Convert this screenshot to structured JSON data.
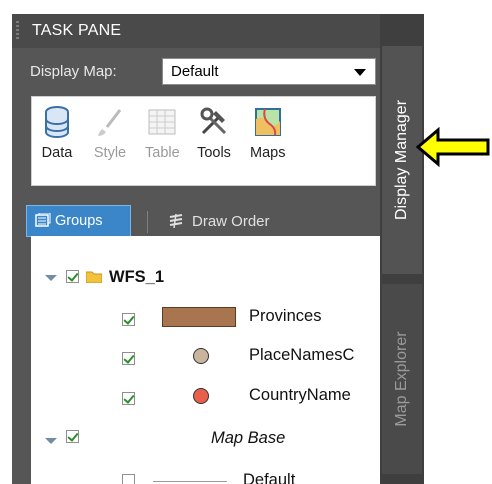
{
  "task_pane": {
    "title": "TASK PANE",
    "display_map_label": "Display Map:",
    "display_map_value": "Default"
  },
  "toolbar": {
    "data": "Data",
    "style": "Style",
    "table": "Table",
    "tools": "Tools",
    "maps": "Maps"
  },
  "view_tabs": {
    "groups": "Groups",
    "draw_order": "Draw Order"
  },
  "layers": {
    "group1": {
      "name": "WFS_1",
      "checked": true,
      "expanded": true
    },
    "items": [
      {
        "name": "Provinces",
        "checked": true,
        "swatch": "#a8754e",
        "style": "polygon"
      },
      {
        "name": "PlaceNamesC",
        "checked": true,
        "swatch": "#c9b49d",
        "style": "point"
      },
      {
        "name": "CountryName",
        "checked": true,
        "swatch": "#e8604c",
        "style": "point"
      }
    ],
    "group2": {
      "name": "Map Base",
      "checked": true,
      "expanded": true
    },
    "base_item": {
      "name": "Default",
      "checked": false
    }
  },
  "side_tabs": {
    "display_manager": "Display Manager",
    "map_explorer": "Map Explorer"
  },
  "colors": {
    "pane_bg": "#565656",
    "selected_tab": "#3b86c9",
    "annotation_arrow": "#ffff00"
  }
}
